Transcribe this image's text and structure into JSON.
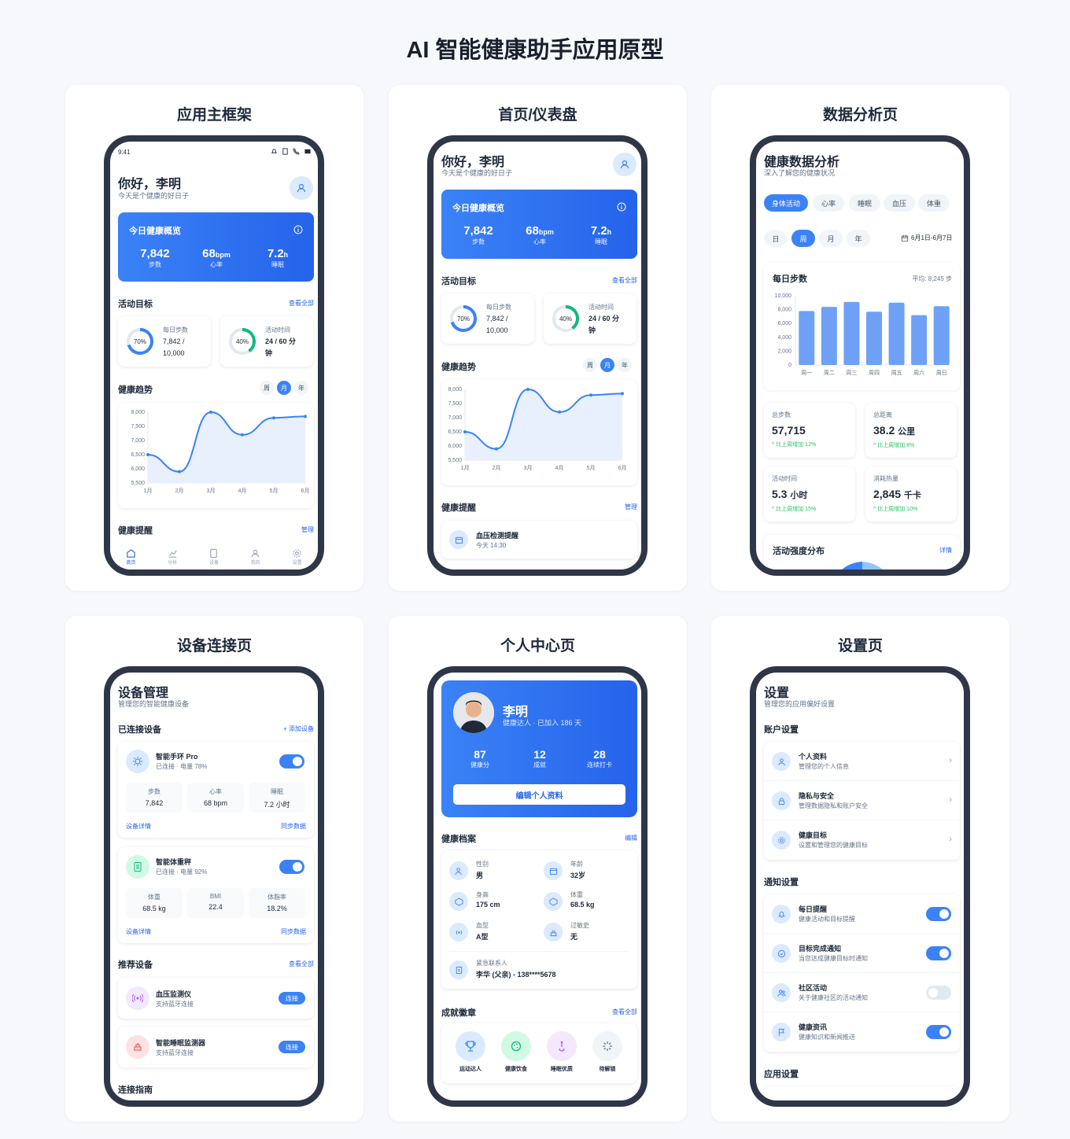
{
  "page_title": "AI 智能健康助手应用原型",
  "cards": {
    "c1": "应用主框架",
    "c2": "首页/仪表盘",
    "c3": "数据分析页",
    "c4": "设备连接页",
    "c5": "个人中心页",
    "c6": "设置页"
  },
  "status_bar": {
    "time": "9:41"
  },
  "home": {
    "greeting": "你好，李明",
    "subtitle": "今天是个健康的好日子",
    "overview_title": "今日健康概览",
    "steps": "7,842",
    "steps_label": "步数",
    "hr": "68",
    "hr_unit": "bpm",
    "hr_label": "心率",
    "sleep": "7.2",
    "sleep_unit": "h",
    "sleep_label": "睡眠",
    "goals_title": "活动目标",
    "view_all": "查看全部",
    "goal1_pct": "70%",
    "goal1_label": "每日步数",
    "goal1_l1": "7,842 /",
    "goal1_l2": "10,000",
    "goal2_pct": "40%",
    "goal2_label": "活动时间",
    "goal2_l1": "24 / 60 分",
    "goal2_l2": "钟",
    "trend_title": "健康趋势",
    "seg": [
      "周",
      "月",
      "年"
    ],
    "reminders_title": "健康提醒",
    "manage": "管理",
    "reminder1_name": "血压检测提醒",
    "reminder1_time": "今天 14:30",
    "nav": [
      "首页",
      "分析",
      "设备",
      "我的",
      "设置"
    ]
  },
  "trend_chart": {
    "type": "line",
    "x": [
      "1月",
      "2月",
      "3月",
      "4月",
      "5月",
      "6月"
    ],
    "values": [
      6500,
      5900,
      8000,
      7200,
      7800,
      7850
    ],
    "yticks": [
      "8,000",
      "7,500",
      "7,000",
      "6,500",
      "6,000",
      "5,500"
    ],
    "ylim": [
      5500,
      8000
    ]
  },
  "analysis": {
    "title": "健康数据分析",
    "subtitle": "深入了解您的健康状况",
    "tabs": [
      "身体活动",
      "心率",
      "睡眠",
      "血压",
      "体重"
    ],
    "periods": [
      "日",
      "周",
      "月",
      "年"
    ],
    "date_range": "6月1日-6月7日",
    "chart_title": "每日步数",
    "avg": "平均: 8,245 步",
    "stats": [
      {
        "label": "总步数",
        "value": "57,715",
        "unit": "",
        "change": "^ 比上周增加 12%"
      },
      {
        "label": "总距离",
        "value": "38.2",
        "unit": "公里",
        "change": "^ 比上周增加 8%"
      },
      {
        "label": "活动时间",
        "value": "5.3",
        "unit": "小时",
        "change": "^ 比上周增加 15%"
      },
      {
        "label": "消耗热量",
        "value": "2,845",
        "unit": "千卡",
        "change": "^ 比上周增加 10%"
      }
    ],
    "intensity_title": "活动强度分布",
    "details": "详情"
  },
  "chart_data": {
    "type": "bar",
    "title": "每日步数",
    "categories": [
      "周一",
      "周二",
      "周三",
      "周四",
      "周五",
      "周六",
      "周日"
    ],
    "values": [
      7800,
      8400,
      9100,
      7700,
      9000,
      7200,
      8500
    ],
    "yticks": [
      "10,000",
      "8,000",
      "6,000",
      "4,000",
      "2,000",
      "0"
    ],
    "ylim": [
      0,
      10000
    ],
    "color": "#6ea1f6"
  },
  "devices": {
    "title": "设备管理",
    "subtitle": "管理您的智能健康设备",
    "connected_title": "已连接设备",
    "add": "+ 添加设备",
    "d1_name": "智能手环 Pro",
    "d1_status": "已连接 · 电量 78%",
    "d1_stats": [
      {
        "l": "步数",
        "v": "7,842"
      },
      {
        "l": "心率",
        "v": "68 bpm"
      },
      {
        "l": "睡眠",
        "v": "7.2 小时"
      }
    ],
    "d2_name": "智能体重秤",
    "d2_status": "已连接 · 电量 92%",
    "d2_stats": [
      {
        "l": "体重",
        "v": "68.5 kg"
      },
      {
        "l": "BMI",
        "v": "22.4"
      },
      {
        "l": "体脂率",
        "v": "18.2%"
      }
    ],
    "detail": "设备详情",
    "sync": "同步数据",
    "rec_title": "推荐设备",
    "view_all": "查看全部",
    "r1_name": "血压监测仪",
    "r1_desc": "支持蓝牙连接",
    "r2_name": "智能睡眠监测器",
    "r2_desc": "支持蓝牙连接",
    "connect": "连接",
    "guide_title": "连接指南"
  },
  "profile": {
    "name": "李明",
    "tagline": "健康达人 · 已加入 186 天",
    "stats": [
      {
        "v": "87",
        "l": "健康分"
      },
      {
        "v": "12",
        "l": "成就"
      },
      {
        "v": "28",
        "l": "连续打卡"
      }
    ],
    "edit": "编辑个人资料",
    "records_title": "健康档案",
    "edit_link": "编辑",
    "records": [
      {
        "l": "性别",
        "v": "男"
      },
      {
        "l": "年龄",
        "v": "32岁"
      },
      {
        "l": "身高",
        "v": "175 cm"
      },
      {
        "l": "体重",
        "v": "68.5 kg"
      },
      {
        "l": "血型",
        "v": "A型"
      },
      {
        "l": "过敏史",
        "v": "无"
      }
    ],
    "emergency_l": "紧急联系人",
    "emergency_v": "李华 (父亲) - 138****5678",
    "badges_title": "成就徽章",
    "view_all": "查看全部",
    "badges": [
      "运动达人",
      "健康饮食",
      "睡眠优质",
      "待解锁"
    ]
  },
  "settings": {
    "title": "设置",
    "subtitle": "管理您的应用偏好设置",
    "account_title": "账户设置",
    "account": [
      {
        "n": "个人资料",
        "d": "管理您的个人信息"
      },
      {
        "n": "隐私与安全",
        "d": "管理数据隐私和账户安全"
      },
      {
        "n": "健康目标",
        "d": "设置和管理您的健康目标"
      }
    ],
    "notify_title": "通知设置",
    "notify": [
      {
        "n": "每日提醒",
        "d": "健康活动和目标提醒"
      },
      {
        "n": "目标完成通知",
        "d": "当您达成健康目标时通知"
      },
      {
        "n": "社区活动",
        "d": "关于健康社区的活动通知"
      },
      {
        "n": "健康资讯",
        "d": "健康知识和新闻推送"
      }
    ],
    "app_title": "应用设置"
  }
}
